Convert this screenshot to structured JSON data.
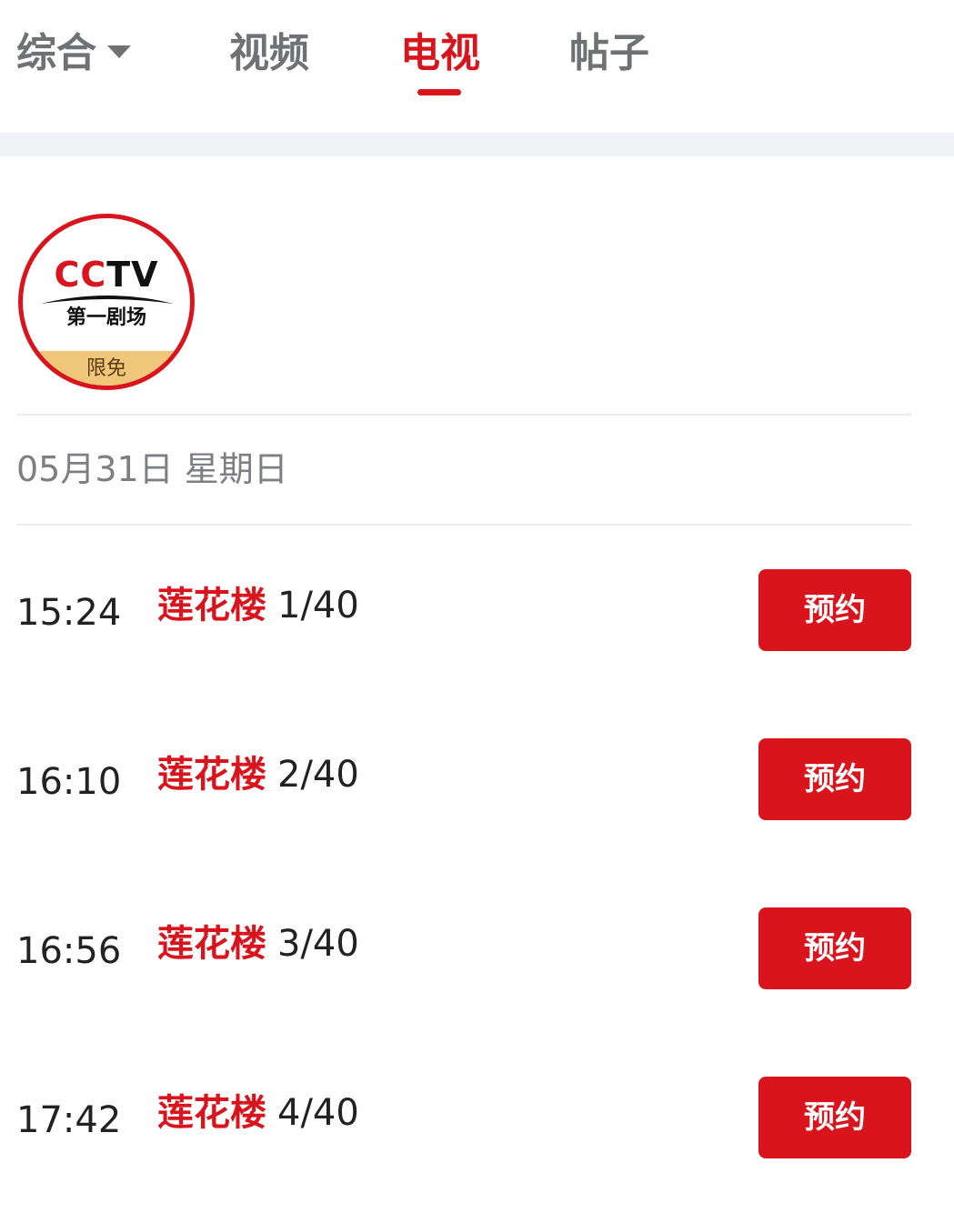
{
  "tabs": [
    {
      "label": "综合",
      "has_dropdown": true,
      "active": false
    },
    {
      "label": "视频",
      "active": false
    },
    {
      "label": "电视",
      "active": true
    },
    {
      "label": "帖子",
      "active": false
    }
  ],
  "channel": {
    "logo_text_a": "C",
    "logo_text_b": "C",
    "logo_text_c": "TV",
    "logo_subtitle": "第一剧场",
    "badge": "限免"
  },
  "date": "05月31日 星期日",
  "schedule": [
    {
      "time": "15:24",
      "name": "莲花楼",
      "episode": "1/40",
      "button": "预约"
    },
    {
      "time": "16:10",
      "name": "莲花楼",
      "episode": "2/40",
      "button": "预约"
    },
    {
      "time": "16:56",
      "name": "莲花楼",
      "episode": "3/40",
      "button": "预约"
    },
    {
      "time": "17:42",
      "name": "莲花楼",
      "episode": "4/40",
      "button": "预约"
    }
  ],
  "colors": {
    "accent": "#d9141c",
    "tab_inactive": "#6f7175",
    "badge_bg": "#f0c77a"
  }
}
